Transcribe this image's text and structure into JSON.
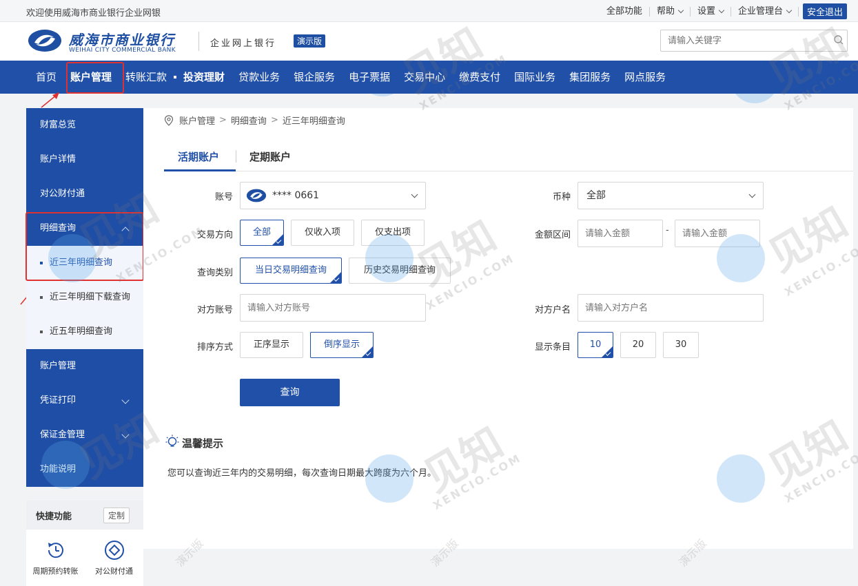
{
  "topbar": {
    "welcome": "欢迎使用威海市商业银行企业网银",
    "all_functions": "全部功能",
    "help": "帮助",
    "settings": "设置",
    "admin": "企业管理台",
    "logout": "安全退出"
  },
  "header": {
    "logo_cn": "威海市商业银行",
    "logo_en": "WEIHAI CITY COMMERCIAL BANK",
    "subtitle": "企业网上银行",
    "badge": "演示版",
    "search_placeholder": "请输入关键字"
  },
  "nav": {
    "items": [
      "首页",
      "账户管理",
      "转账汇款",
      "投资理财",
      "贷款业务",
      "银企服务",
      "电子票据",
      "交易中心",
      "缴费支付",
      "国际业务",
      "集团服务",
      "网点服务"
    ]
  },
  "sidebar": {
    "items": [
      "财富总览",
      "账户详情",
      "对公财付通",
      "明细查询",
      "账户管理",
      "凭证打印",
      "保证金管理",
      "功能说明"
    ],
    "sub_items": [
      "近三年明细查询",
      "近三年明细下载查询",
      "近五年明细查询"
    ]
  },
  "quick": {
    "title": "快捷功能",
    "customize": "定制",
    "items": [
      "周期预约转账",
      "对公财付通"
    ]
  },
  "breadcrumb": [
    "账户管理",
    "明细查询",
    "近三年明细查询"
  ],
  "tabs": [
    "活期账户",
    "定期账户"
  ],
  "form": {
    "account_label": "账号",
    "account_value": "**** 0661",
    "currency_label": "币种",
    "currency_value": "全部",
    "direction_label": "交易方向",
    "direction_options": [
      "全部",
      "仅收入项",
      "仅支出项"
    ],
    "amount_label": "金额区间",
    "amount_placeholder": "请输入金额",
    "amount_dash": "-",
    "type_label": "查询类别",
    "type_options": [
      "当日交易明细查询",
      "历史交易明细查询"
    ],
    "peer_account_label": "对方账号",
    "peer_account_placeholder": "请输入对方账号",
    "peer_name_label": "对方户名",
    "peer_name_placeholder": "请输入对方户名",
    "sort_label": "排序方式",
    "sort_options": [
      "正序显示",
      "倒序显示"
    ],
    "count_label": "显示条目",
    "count_options": [
      "10",
      "20",
      "30"
    ],
    "query_button": "查询"
  },
  "tips": {
    "title": "温馨提示",
    "text": "您可以查询近三年内的交易明细，每次查询日期最大跨度为六个月。"
  },
  "watermark": {
    "cn": "见知",
    "en": "XENCIO.COM",
    "demo": "演示版"
  },
  "colors": {
    "primary": "#2150a8",
    "highlight": "#e03030"
  }
}
